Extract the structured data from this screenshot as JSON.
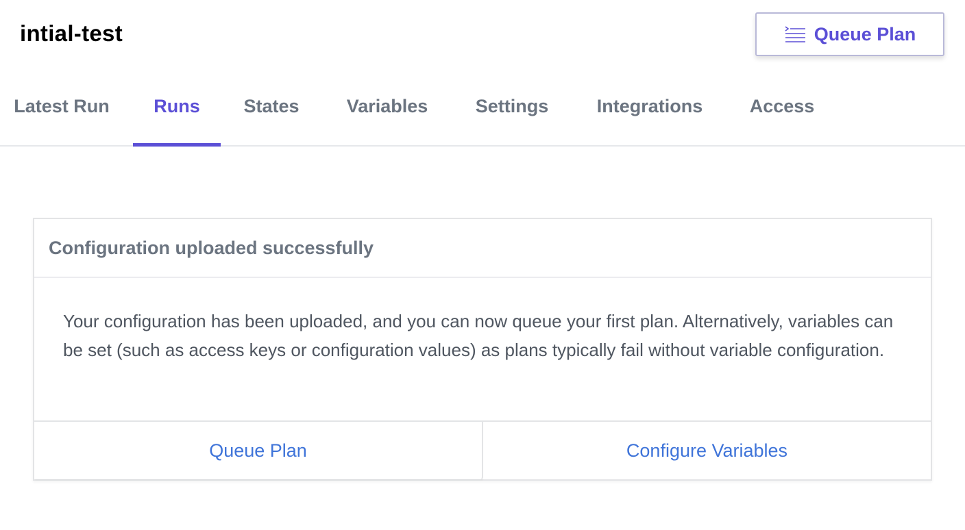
{
  "header": {
    "title": "intial-test",
    "queue_plan_button": {
      "label": "Queue Plan",
      "icon": "queue-list-icon"
    }
  },
  "tabs": [
    {
      "label": "Latest Run",
      "active": false
    },
    {
      "label": "Runs",
      "active": true
    },
    {
      "label": "States",
      "active": false
    },
    {
      "label": "Variables",
      "active": false
    },
    {
      "label": "Settings",
      "active": false
    },
    {
      "label": "Integrations",
      "active": false
    },
    {
      "label": "Access",
      "active": false
    }
  ],
  "card": {
    "title": "Configuration uploaded successfully",
    "body": "Your configuration has been uploaded, and you can now queue your first plan. Alternatively, variables can be set (such as access keys or configuration values) as plans typically fail without variable configuration.",
    "actions": {
      "queue_plan": "Queue Plan",
      "configure_variables": "Configure Variables"
    }
  },
  "colors": {
    "accent": "#5b4fd6",
    "link": "#3f74d9",
    "muted_text": "#6b7480",
    "body_text": "#4f5660",
    "border": "#e3e4e6"
  }
}
